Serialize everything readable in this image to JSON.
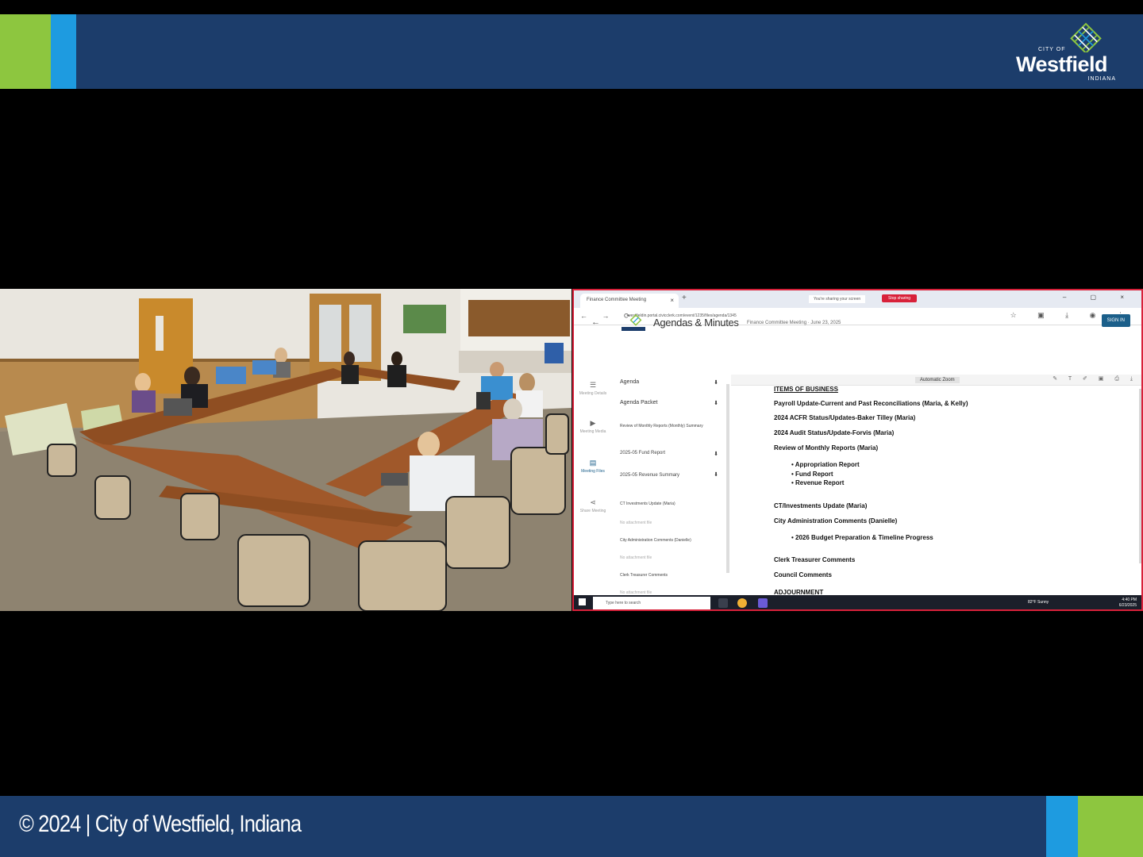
{
  "banner": {
    "logo_city_of": "CITY OF",
    "logo_name": "Westfield",
    "logo_state": "INDIANA",
    "footer_text": "© 2024 | City of Westfield, Indiana",
    "colors": {
      "navy": "#1c3d6b",
      "blue": "#1e9be0",
      "green": "#8dc63f"
    }
  },
  "room_video": {
    "description_icon": "meeting-room-camera"
  },
  "share": {
    "tab_title": "Finance Committee Meeting",
    "sharing_message": "You're sharing your screen",
    "stop_label": "Stop sharing",
    "url": "westfieldin.portal.civicclerk.com/event/1235/files/agenda/1345",
    "page_title": "Agendas & Minutes",
    "page_subtitle": "Finance Committee Meeting · June 23, 2025",
    "sign_in": "SIGN IN",
    "rail": [
      {
        "label": "Meeting Details",
        "icon": "list-icon"
      },
      {
        "label": "Meeting Media",
        "icon": "video-icon"
      },
      {
        "label": "Meeting Files",
        "icon": "files-icon"
      },
      {
        "label": "Share Meeting",
        "icon": "share-icon"
      }
    ],
    "attachments": [
      {
        "label": "Agenda"
      },
      {
        "label": "Agenda Packet"
      },
      {
        "label": "Review of Monthly Reports (Monthly) Summary"
      },
      {
        "label": "2025-05 Fund Report"
      },
      {
        "label": "2025-05 Revenue Summary"
      },
      {
        "label": "CT Investments Update (Maria)"
      },
      {
        "label": "No attachment file"
      },
      {
        "label": "City Administration Comments (Danielle)"
      },
      {
        "label": "No attachment file"
      },
      {
        "label": "Clerk Treasurer Comments"
      },
      {
        "label": "No attachment file"
      }
    ],
    "zoom": "Automatic Zoom",
    "agenda": {
      "heading": "ITEMS OF BUSINESS",
      "items": [
        "Payroll Update-Current and Past Reconciliations (Maria, & Kelly)",
        "2024 ACFR Status/Updates-Baker Tilley (Maria)",
        "2024 Audit Status/Update-Forvis (Maria)",
        "Review of Monthly Reports (Maria)"
      ],
      "monthly_reports": [
        "Appropriation Report",
        "Fund Report",
        "Revenue Report"
      ],
      "ct_investments": "CT/Investments Update (Maria)",
      "city_admin": "City Administration Comments (Danielle)",
      "city_admin_bullets": [
        "2026 Budget Preparation & Timeline Progress"
      ],
      "clerk": "Clerk Treasurer Comments",
      "council": "Council Comments",
      "adjournment": "ADJOURNMENT"
    },
    "taskbar": {
      "search_placeholder": "Type here to search",
      "weather": "82°F Sunny",
      "time": "4:40 PM",
      "date": "6/23/2025"
    }
  }
}
